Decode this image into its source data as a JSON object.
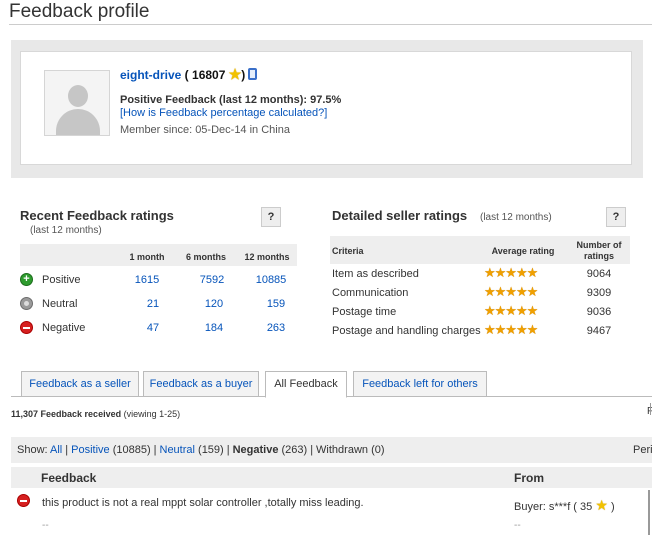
{
  "page": {
    "title": "Feedback profile"
  },
  "profile": {
    "username": "eight-drive",
    "score": "16807",
    "positive_label": "Positive Feedback (last 12 months): 97.5%",
    "calc_link": "[How is Feedback percentage calculated?]",
    "member_since": "Member since: 05-Dec-14 in China",
    "icons": {
      "avatar": "user-silhouette",
      "star": "yellow-shooting-star",
      "badge": "mobile-badge"
    }
  },
  "recent": {
    "heading": "Recent Feedback ratings",
    "sub": "(last 12 months)",
    "help": "?",
    "columns": [
      "1 month",
      "6 months",
      "12 months"
    ],
    "rows": [
      {
        "label": "Positive",
        "icon": "positive-plus",
        "values": [
          "1615",
          "7592",
          "10885"
        ]
      },
      {
        "label": "Neutral",
        "icon": "neutral-dot",
        "values": [
          "21",
          "120",
          "159"
        ]
      },
      {
        "label": "Negative",
        "icon": "negative-minus",
        "values": [
          "47",
          "184",
          "263"
        ]
      }
    ]
  },
  "dsr": {
    "heading": "Detailed seller ratings",
    "sub": "(last 12 months)",
    "help": "?",
    "col_criteria": "Criteria",
    "col_avg": "Average rating",
    "col_num_1": "Number of",
    "col_num_2": "ratings",
    "rows": [
      {
        "label": "Item as described",
        "rating": 5,
        "count": "9064"
      },
      {
        "label": "Communication",
        "rating": 5,
        "count": "9309"
      },
      {
        "label": "Postage time",
        "rating": 4.9,
        "count": "9036"
      },
      {
        "label": "Postage and handling charges",
        "rating": 5,
        "count": "9467"
      }
    ]
  },
  "tabs": [
    {
      "label": "Feedback as a seller",
      "active": false
    },
    {
      "label": "Feedback as a buyer",
      "active": false
    },
    {
      "label": "All Feedback",
      "active": true
    },
    {
      "label": "Feedback left for others",
      "active": false
    }
  ],
  "received": {
    "count": "11,307 Feedback received",
    "viewing": "(viewing 1-25)",
    "edge": "F"
  },
  "show": {
    "label": "Show:",
    "all": "All",
    "positive": "Positive",
    "positive_count": "(10885)",
    "neutral": "Neutral",
    "neutral_count": "(159)",
    "negative": "Negative",
    "negative_count": "(263)",
    "withdrawn": "Withdrawn",
    "withdrawn_count": "(0)",
    "period": "Peri"
  },
  "feedback_table": {
    "col_feedback": "Feedback",
    "col_from": "From",
    "rows": [
      {
        "type": "negative",
        "text": "this product is not a real mppt solar controller ,totally miss leading.",
        "from": "Buyer: s***f ( 35",
        "from_close": ")",
        "dash1": "--",
        "dash2": "--"
      }
    ]
  }
}
